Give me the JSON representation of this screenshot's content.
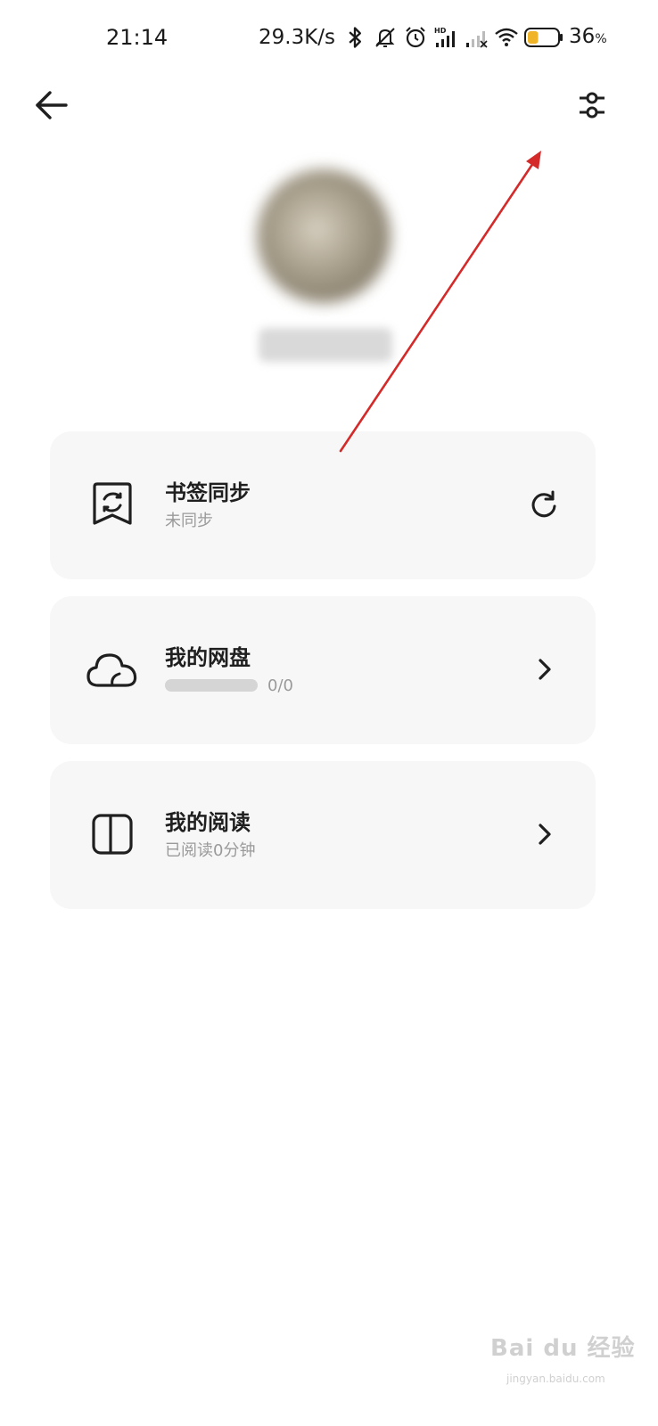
{
  "status_bar": {
    "time": "21:14",
    "net_speed": "29.3K/s",
    "battery_percent": "36",
    "battery_percent_sign": "%",
    "battery_level": 0.36,
    "icons": [
      "bluetooth-icon",
      "mute-icon",
      "alarm-icon",
      "signal-hd-icon",
      "signal-icon",
      "wifi-icon",
      "battery-icon"
    ]
  },
  "toolbar": {
    "back_icon": "arrow-left-icon",
    "settings_icon": "sliders-icon"
  },
  "cards": {
    "bookmark_sync": {
      "title": "书签同步",
      "subtitle": "未同步",
      "icon": "bookmark-sync-icon",
      "action_icon": "refresh-icon"
    },
    "cloud_drive": {
      "title": "我的网盘",
      "usage": "0/0",
      "usage_fraction": 0,
      "icon": "cloud-icon",
      "action_icon": "chevron-right-icon"
    },
    "reading": {
      "title": "我的阅读",
      "subtitle": "已阅读0分钟",
      "icon": "book-icon",
      "action_icon": "chevron-right-icon"
    }
  },
  "watermark": {
    "text": "Bai du 经验",
    "sub": "jingyan.baidu.com"
  },
  "colors": {
    "card_bg": "#f7f7f7",
    "annotation_arrow": "#d42a2a",
    "battery_fill": "#f0b429"
  }
}
